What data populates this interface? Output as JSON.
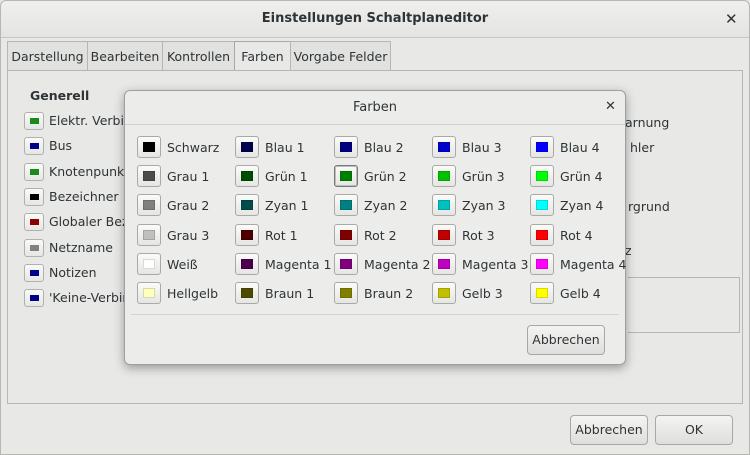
{
  "window": {
    "title": "Einstellungen Schaltplaneditor",
    "close_icon": "close-icon",
    "close_glyph": "✕"
  },
  "tabs": [
    {
      "label": "Darstellung"
    },
    {
      "label": "Bearbeiten"
    },
    {
      "label": "Kontrollen"
    },
    {
      "label": "Farben",
      "active": true
    },
    {
      "label": "Vorgabe Felder"
    }
  ],
  "background_panel": {
    "general_header": "Generell",
    "general_items": [
      {
        "label": "Elektr. Verbind",
        "color": "#1a8a1a"
      },
      {
        "label": "Bus",
        "color": "#00008b"
      },
      {
        "label": "Knotenpunkt",
        "color": "#1a8a1a"
      },
      {
        "label": "Bezeichner",
        "color": "#000000"
      },
      {
        "label": "Globaler Bezei",
        "color": "#8b0000"
      },
      {
        "label": "Netzname",
        "color": "#808080"
      },
      {
        "label": "Notizen",
        "color": "#00008b"
      },
      {
        "label": "'Keine-Verbind",
        "color": "#00008b"
      }
    ],
    "right_texts": {
      "line1": "arnung",
      "line2": "hler",
      "frame_title": "rgrund",
      "frame_text": "z"
    }
  },
  "footer": {
    "cancel_label": "Abbrechen",
    "ok_label": "OK"
  },
  "dialog": {
    "title": "Farben",
    "close_glyph": "✕",
    "cancel_label": "Abbrechen",
    "selected": "Grün 2",
    "colors": [
      [
        {
          "name": "Schwarz",
          "hex": "#000000"
        },
        {
          "name": "Blau 1",
          "hex": "#00004c"
        },
        {
          "name": "Blau 2",
          "hex": "#00007f"
        },
        {
          "name": "Blau 3",
          "hex": "#0000cc"
        },
        {
          "name": "Blau 4",
          "hex": "#0000ff"
        }
      ],
      [
        {
          "name": "Grau 1",
          "hex": "#4c4c4c"
        },
        {
          "name": "Grün 1",
          "hex": "#004c00"
        },
        {
          "name": "Grün 2",
          "hex": "#008000"
        },
        {
          "name": "Grün 3",
          "hex": "#00c000"
        },
        {
          "name": "Grün 4",
          "hex": "#00ff00"
        }
      ],
      [
        {
          "name": "Grau 2",
          "hex": "#808080"
        },
        {
          "name": "Zyan 1",
          "hex": "#004c4c"
        },
        {
          "name": "Zyan 2",
          "hex": "#008080"
        },
        {
          "name": "Zyan 3",
          "hex": "#00c0c0"
        },
        {
          "name": "Zyan 4",
          "hex": "#00ffff"
        }
      ],
      [
        {
          "name": "Grau 3",
          "hex": "#c0c0c0"
        },
        {
          "name": "Rot 1",
          "hex": "#4c0000"
        },
        {
          "name": "Rot 2",
          "hex": "#800000"
        },
        {
          "name": "Rot 3",
          "hex": "#c00000"
        },
        {
          "name": "Rot 4",
          "hex": "#ff0000"
        }
      ],
      [
        {
          "name": "Weiß",
          "hex": "#ffffff"
        },
        {
          "name": "Magenta 1",
          "hex": "#4c004c"
        },
        {
          "name": "Magenta 2",
          "hex": "#800080"
        },
        {
          "name": "Magenta 3",
          "hex": "#c000c0"
        },
        {
          "name": "Magenta 4",
          "hex": "#ff00ff"
        }
      ],
      [
        {
          "name": "Hellgelb",
          "hex": "#ffffc0"
        },
        {
          "name": "Braun 1",
          "hex": "#4c4c00"
        },
        {
          "name": "Braun 2",
          "hex": "#808000"
        },
        {
          "name": "Gelb 3",
          "hex": "#c0c000"
        },
        {
          "name": "Gelb 4",
          "hex": "#ffff00"
        }
      ]
    ]
  }
}
